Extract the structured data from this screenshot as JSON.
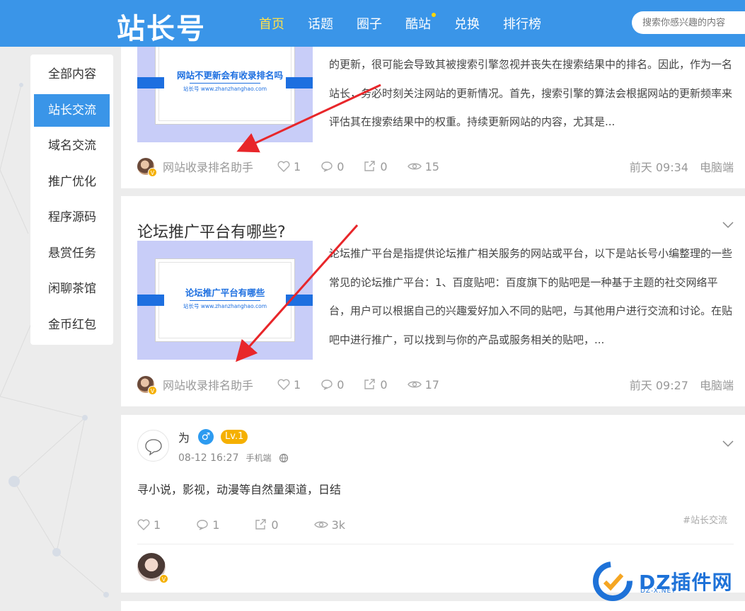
{
  "header": {
    "logo": "站长号",
    "nav": [
      {
        "label": "首页",
        "active": true
      },
      {
        "label": "话题"
      },
      {
        "label": "圈子"
      },
      {
        "label": "酷站",
        "dot": true
      },
      {
        "label": "兑换"
      },
      {
        "label": "排行榜"
      }
    ],
    "search_placeholder": "搜索你感兴趣的内容"
  },
  "sidebar": {
    "items": [
      {
        "label": "全部内容"
      },
      {
        "label": "站长交流",
        "active": true
      },
      {
        "label": "域名交流"
      },
      {
        "label": "推广优化"
      },
      {
        "label": "程序源码"
      },
      {
        "label": "悬赏任务"
      },
      {
        "label": "闲聊茶馆"
      },
      {
        "label": "金币红包"
      }
    ]
  },
  "cards": [
    {
      "thumb_title": "网站不更新会有收录排名吗",
      "thumb_url": "站长号 www.zhanzhanghao.com",
      "excerpt": "的更新，很可能会导致其被搜索引擎忽视并丧失在搜索结果中的排名。因此，作为一名站长，务必时刻关注网站的更新情况。首先，搜索引擎的算法会根据网站的更新频率来评估其在搜索结果中的权重。持续更新网站的内容，尤其是...",
      "author": "网站收录排名助手",
      "likes": "1",
      "comments": "0",
      "shares": "0",
      "views": "15",
      "time": "前天 09:34",
      "device": "电脑端"
    },
    {
      "title": "论坛推广平台有哪些?",
      "thumb_title": "论坛推广平台有哪些",
      "thumb_url": "站长号 www.zhanzhanghao.com",
      "excerpt": "论坛推广平台是指提供论坛推广相关服务的网站或平台，以下是站长号小编整理的一些常见的论坛推广平台：1、百度贴吧：百度旗下的贴吧是一种基于主题的社交网络平台，用户可以根据自己的兴趣爱好加入不同的贴吧，与其他用户进行交流和讨论。在贴吧中进行推广，可以找到与你的产品或服务相关的贴吧，...",
      "author": "网站收录排名助手",
      "likes": "1",
      "comments": "0",
      "shares": "0",
      "views": "17",
      "time": "前天 09:27",
      "device": "电脑端"
    }
  ],
  "post": {
    "username": "为",
    "gender_symbol": "♂",
    "level": "Lv.1",
    "date": "08-12 16:27",
    "device": "手机端",
    "content": "寻小说，影视，动漫等自然量渠道，日结",
    "likes": "1",
    "comments": "1",
    "shares": "0",
    "views": "3k",
    "tag": "#站长交流"
  },
  "watermark": {
    "text": "DZ插件网",
    "sub": "DZ-X.NET"
  },
  "colors": {
    "header": "#3a95e8",
    "accent_nav": "#ffe04a",
    "thumb_bg": "#c8cdf8",
    "thumb_blue": "#1d6fe0",
    "badge": "#f5b000",
    "arrow": "#e8262a"
  }
}
